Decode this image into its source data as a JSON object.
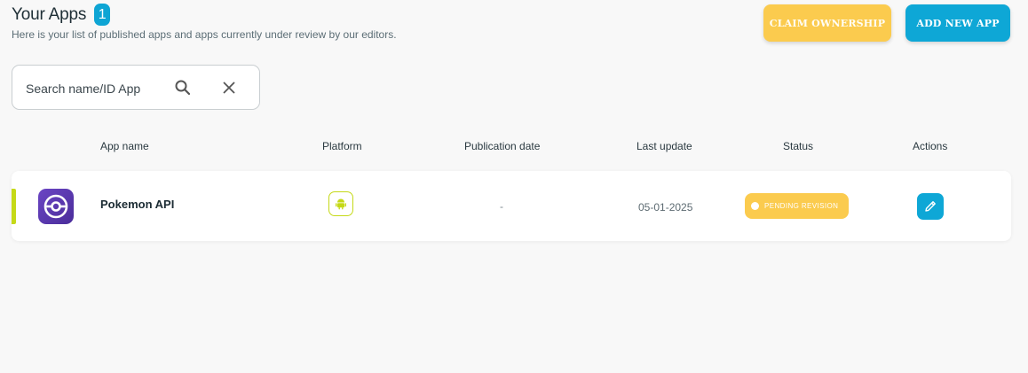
{
  "header": {
    "title": "Your Apps",
    "count": "1",
    "subtitle": "Here is your list of published apps and apps currently under review by our editors."
  },
  "toolbar": {
    "claim_label": "CLAIM OWNERSHIP",
    "add_label": "ADD NEW APP"
  },
  "search": {
    "placeholder": "Search name/ID App",
    "value": ""
  },
  "table": {
    "columns": [
      "App name",
      "Platform",
      "Publication date",
      "Last update",
      "Status",
      "Actions"
    ],
    "rows": [
      {
        "name": "Pokemon API",
        "platform": "android-icon",
        "publication_date": "-",
        "last_update": "05-01-2025",
        "status": "PENDING REVISION"
      }
    ]
  },
  "colors": {
    "accent_blue": "#0ea7d6",
    "accent_yellow": "#fbcb4e",
    "android_green": "#c5d917",
    "app_icon_purple": "#5b3ab4"
  },
  "icons": [
    "search-icon",
    "close-icon",
    "android-icon",
    "pokeball-icon",
    "pencil-icon"
  ]
}
